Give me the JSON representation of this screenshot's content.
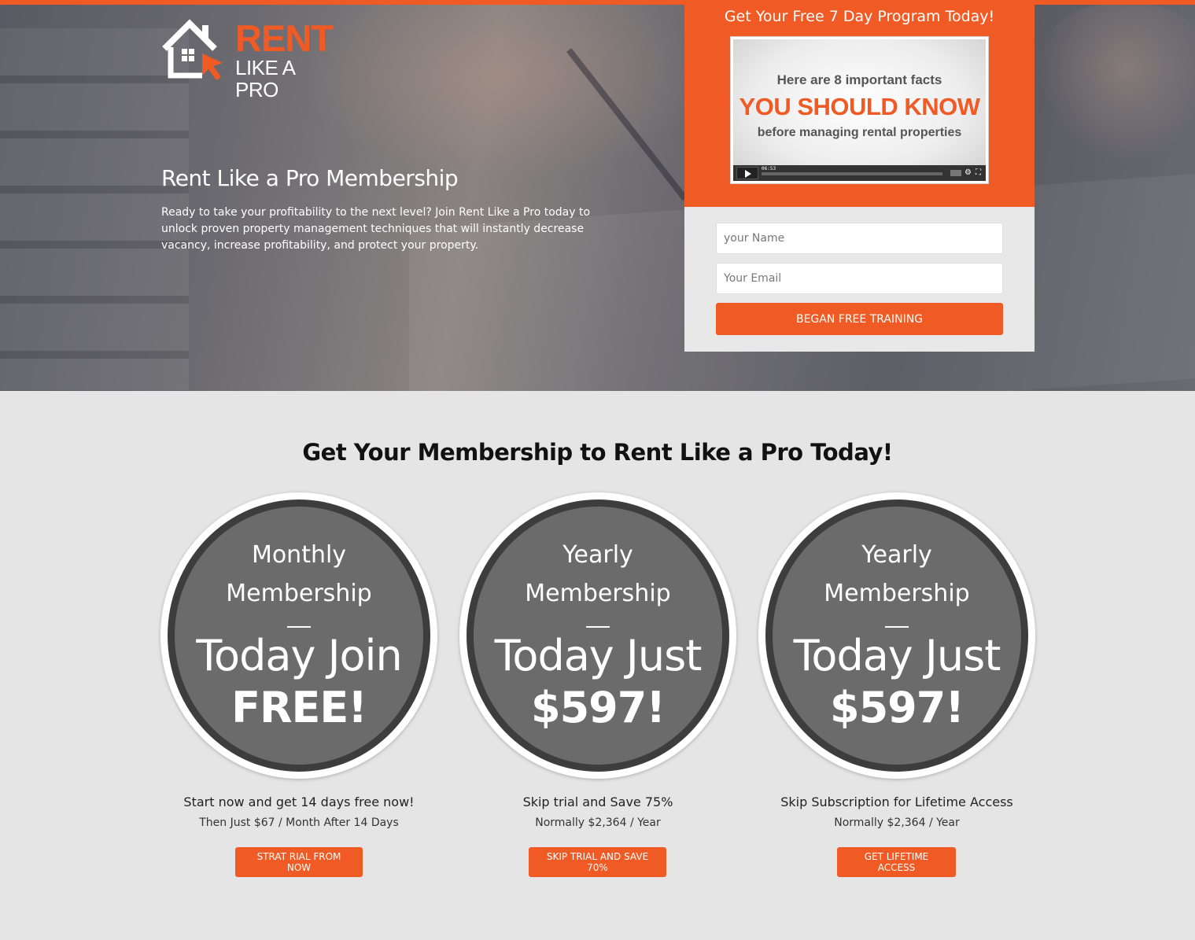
{
  "brand": {
    "word1": "RENT",
    "word2": "LIKE A PRO",
    "accent_color": "#f05a24"
  },
  "hero": {
    "title": "Rent Like a Pro Membership",
    "text": "Ready to take your profitability to the next level? Join Rent Like a Pro today to unlock proven property management techniques that will instantly decrease vacancy, increase profitability, and protect your property."
  },
  "signup": {
    "title": "Get Your Free 7 Day Program Today!",
    "video": {
      "line1": "Here are 8 important facts",
      "line2": "YOU SHOULD KNOW",
      "line3": "before managing rental properties",
      "time": "06:53"
    },
    "name_placeholder": "your Name",
    "email_placeholder": "Your Email",
    "button_label": "BEGAN FREE TRAINING"
  },
  "pricing": {
    "title": "Get Your Membership to Rent Like a Pro Today!",
    "plans": [
      {
        "line1": "Monthly",
        "line2": "Membership",
        "big1": "Today Join",
        "big2": "FREE!",
        "subtitle": "Start now and get 14 days free now!",
        "note": "Then Just $67 / Month After 14 Days",
        "button": "STRAT RIAL FROM NOW"
      },
      {
        "line1": "Yearly",
        "line2": "Membership",
        "big1": "Today Just",
        "big2": "$597!",
        "subtitle": "Skip trial and Save 75%",
        "note": "Normally $2,364 / Year",
        "button": "SKIP TRIAL AND SAVE 70%"
      },
      {
        "line1": "Yearly",
        "line2": "Membership",
        "big1": "Today Just",
        "big2": "$597!",
        "subtitle": "Skip Subscription for Lifetime Access",
        "note": "Normally $2,364 / Year",
        "button": "GET LIFETIME ACCESS"
      }
    ]
  }
}
